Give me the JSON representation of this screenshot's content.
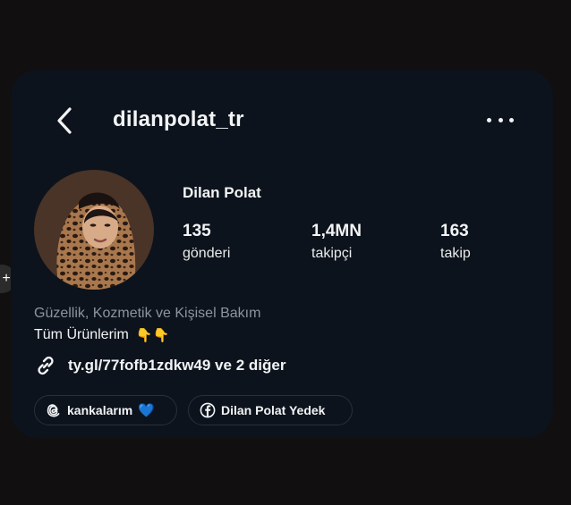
{
  "header": {
    "username": "dilanpolat_tr",
    "back_icon": "chevron-left-icon",
    "more_icon": "more-horizontal-icon"
  },
  "profile": {
    "display_name": "Dilan Polat",
    "stats": [
      {
        "value": "135",
        "label": "gönderi"
      },
      {
        "value": "1,4MN",
        "label": "takipçi"
      },
      {
        "value": "163",
        "label": "takip"
      }
    ],
    "category": "Güzellik, Kozmetik ve Kişisel Bakım",
    "bio": "Tüm Ürünlerim",
    "bio_emoji": "👇👇",
    "link": "ty.gl/77fofb1zdkw49 ve 2 diğer"
  },
  "pills": {
    "threads_label": "kankalarım",
    "threads_heart": "💙",
    "facebook_label": "Dilan Polat Yedek"
  },
  "colors": {
    "background": "#110f0f",
    "card": "#0c131c",
    "text": "#f2f3f5",
    "muted": "#8d949c"
  }
}
